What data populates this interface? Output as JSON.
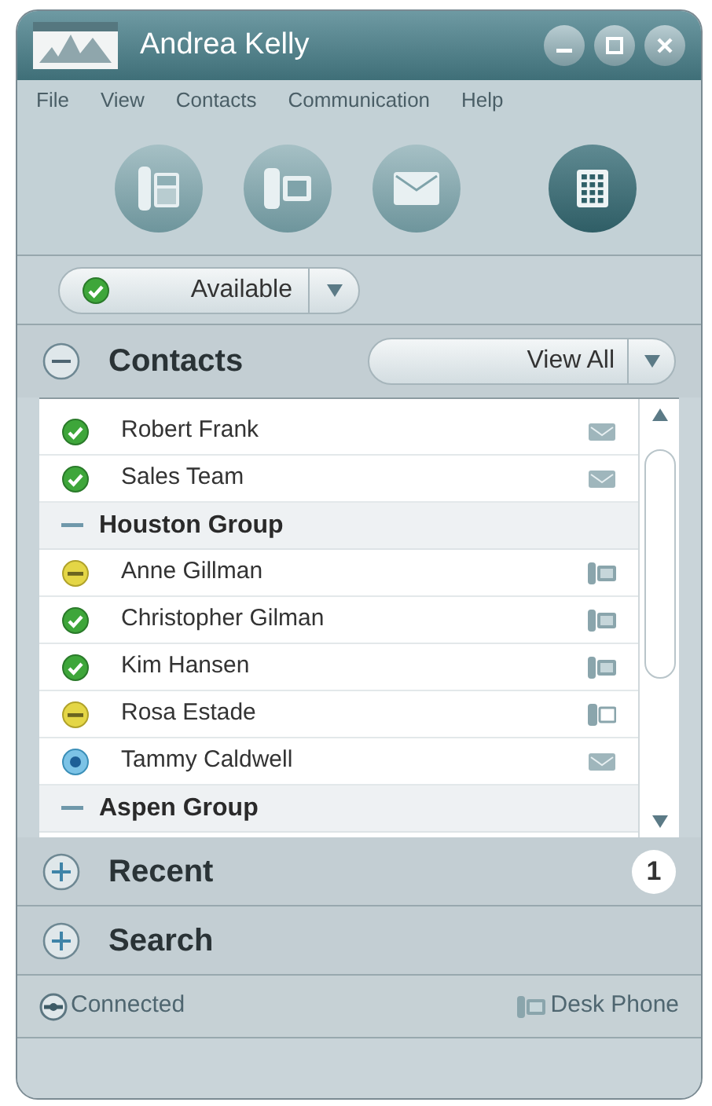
{
  "window": {
    "title": "Andrea Kelly"
  },
  "menu": [
    "File",
    "View",
    "Contacts",
    "Communication",
    "Help"
  ],
  "toolbar": [
    {
      "kind": "phone",
      "selected": false
    },
    {
      "kind": "video",
      "selected": false
    },
    {
      "kind": "mail",
      "selected": false
    },
    {
      "kind": "keypad",
      "selected": true
    }
  ],
  "presence": {
    "label": "Available",
    "status": {
      "kind": "available"
    }
  },
  "contacts": {
    "title": "Contacts",
    "expanded": true,
    "filter": "View All",
    "items": [
      {
        "kind": "contact",
        "name": "Robert Frank",
        "status": {
          "kind": "available"
        },
        "device": {
          "kind": "chat"
        }
      },
      {
        "kind": "contact",
        "name": "Sales Team",
        "status": {
          "kind": "available"
        },
        "device": {
          "kind": "chat"
        }
      },
      {
        "kind": "group",
        "name": "Houston Group",
        "expanded": true,
        "children": [
          {
            "kind": "contact",
            "name": "Anne Gillman",
            "status": {
              "kind": "away"
            },
            "device": {
              "kind": "phone"
            }
          },
          {
            "kind": "contact",
            "name": "Christopher Gilman",
            "status": {
              "kind": "available"
            },
            "device": {
              "kind": "phone"
            }
          },
          {
            "kind": "contact",
            "name": "Kim Hansen",
            "status": {
              "kind": "available"
            },
            "device": {
              "kind": "phone"
            }
          },
          {
            "kind": "contact",
            "name": "Rosa Estade",
            "status": {
              "kind": "away"
            },
            "device": {
              "kind": "video"
            }
          },
          {
            "kind": "contact",
            "name": "Tammy Caldwell",
            "status": {
              "kind": "online"
            },
            "device": {
              "kind": "chat"
            }
          }
        ]
      },
      {
        "kind": "group",
        "name": "Aspen Group",
        "expanded": true
      }
    ]
  },
  "panels": [
    {
      "title": "Recent",
      "expanded": false,
      "badge": "1"
    },
    {
      "title": "Search",
      "expanded": false
    }
  ],
  "status_bar": {
    "connection": "Connected",
    "device": "Desk Phone"
  }
}
